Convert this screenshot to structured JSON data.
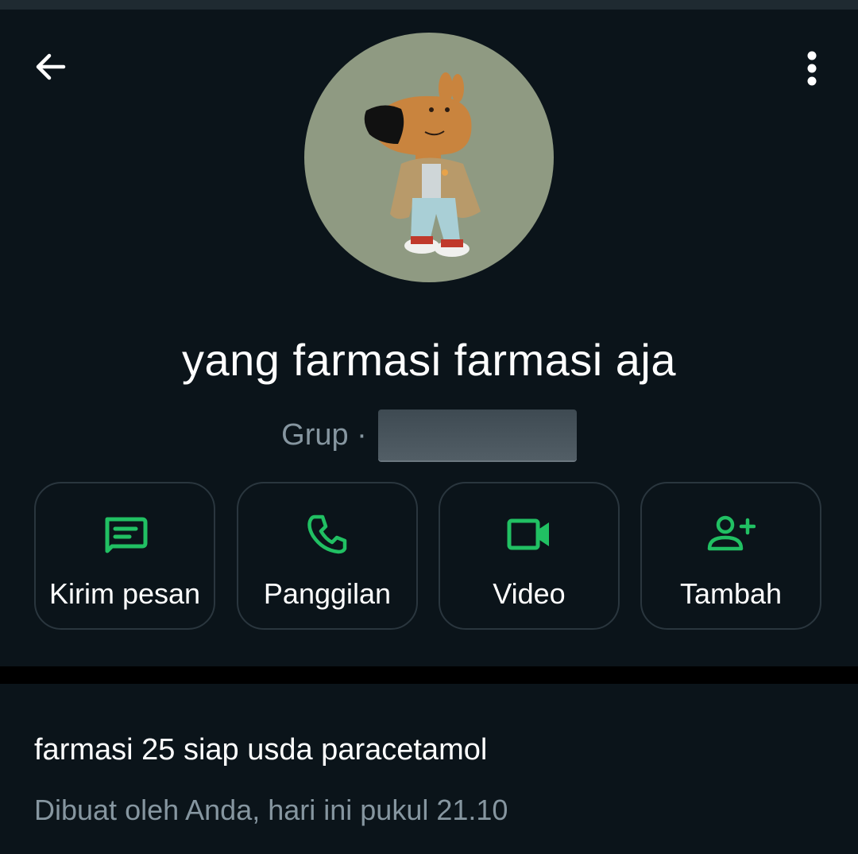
{
  "header": {
    "back_icon": "arrow-left-icon",
    "menu_icon": "more-vertical-icon"
  },
  "group": {
    "name": "yang farmasi farmasi aja",
    "subtitle": "Grup ·"
  },
  "actions": [
    {
      "label": "Kirim pesan",
      "icon": "message-icon"
    },
    {
      "label": "Panggilan",
      "icon": "phone-icon"
    },
    {
      "label": "Video",
      "icon": "video-icon"
    },
    {
      "label": "Tambah",
      "icon": "add-person-icon"
    }
  ],
  "description": {
    "title": "farmasi 25 siap usda paracetamol",
    "meta": "Dibuat oleh Anda, hari ini pukul 21.10"
  },
  "colors": {
    "background": "#0b141a",
    "accent": "#21c063",
    "muted_text": "#8696a0"
  }
}
